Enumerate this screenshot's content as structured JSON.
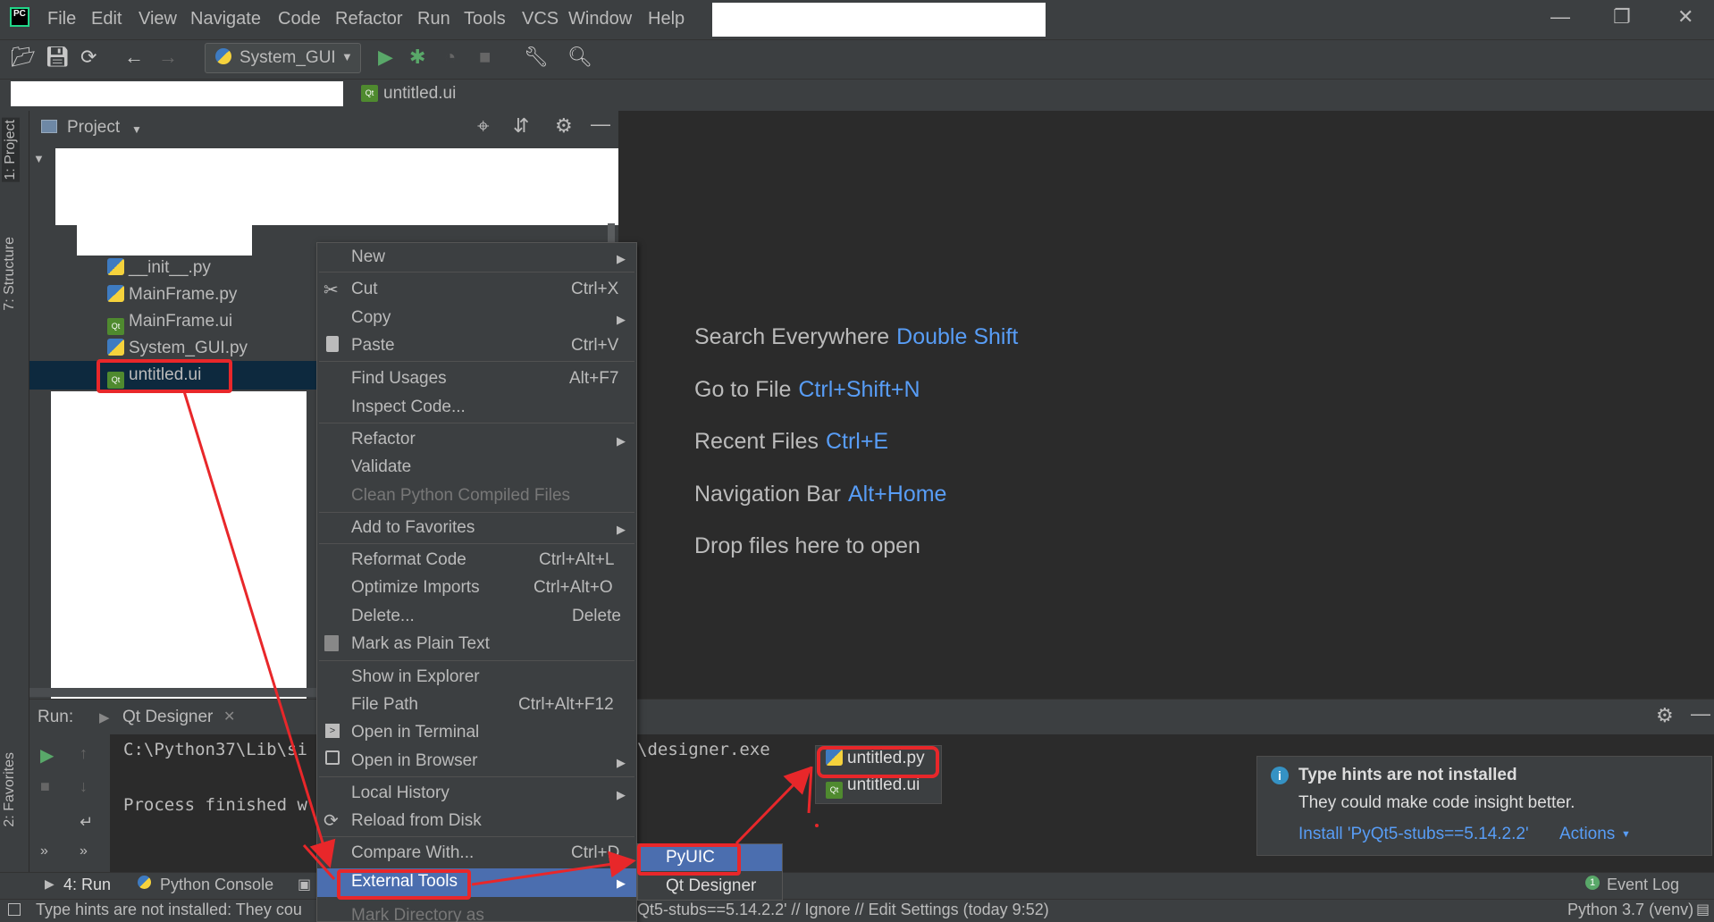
{
  "menubar": {
    "items": [
      "File",
      "Edit",
      "View",
      "Navigate",
      "Code",
      "Refactor",
      "Run",
      "Tools",
      "VCS",
      "Window",
      "Help"
    ],
    "logo_text": "PC"
  },
  "window_controls": {
    "minimize": "—",
    "restore": "❐",
    "close": "✕"
  },
  "toolbar": {
    "run_config": "System_GUI"
  },
  "breadcrumb": {
    "file": "untitled.ui"
  },
  "left_stripe": {
    "project_tab": "1: Project",
    "structure_tab": "7: Structure",
    "favorites_tab": "2: Favorites"
  },
  "project": {
    "title": "Project",
    "files": [
      "__init__.py",
      "MainFrame.py",
      "MainFrame.ui",
      "System_GUI.py",
      "untitled.ui"
    ]
  },
  "editor_hints": [
    {
      "label": "Search Everywhere",
      "key": "Double Shift"
    },
    {
      "label": "Go to File",
      "key": "Ctrl+Shift+N"
    },
    {
      "label": "Recent Files",
      "key": "Ctrl+E"
    },
    {
      "label": "Navigation Bar",
      "key": "Alt+Home"
    },
    {
      "label": "Drop files here to open",
      "key": ""
    }
  ],
  "run_panel": {
    "label": "Run:",
    "tab": "Qt Designer",
    "line1_start": "C:\\Python37\\Lib\\si",
    "line1_end": "\\designer.exe",
    "line2": "Process finished w"
  },
  "context_menu": {
    "new": "New",
    "cut": "Cut",
    "cut_sc": "Ctrl+X",
    "copy": "Copy",
    "paste": "Paste",
    "paste_sc": "Ctrl+V",
    "find_usages": "Find Usages",
    "find_usages_sc": "Alt+F7",
    "inspect_code": "Inspect Code...",
    "refactor": "Refactor",
    "validate": "Validate",
    "clean_python": "Clean Python Compiled Files",
    "add_favorites": "Add to Favorites",
    "reformat": "Reformat Code",
    "reformat_sc": "Ctrl+Alt+L",
    "optimize": "Optimize Imports",
    "optimize_sc": "Ctrl+Alt+O",
    "delete": "Delete...",
    "delete_sc": "Delete",
    "mark_plain": "Mark as Plain Text",
    "show_explorer": "Show in Explorer",
    "file_path": "File Path",
    "file_path_sc": "Ctrl+Alt+F12",
    "open_terminal": "Open in Terminal",
    "open_browser": "Open in Browser",
    "local_history": "Local History",
    "reload_disk": "Reload from Disk",
    "compare_with": "Compare With...",
    "compare_sc": "Ctrl+D",
    "external_tools": "External Tools",
    "mark_directory": "Mark Directory as"
  },
  "submenu": {
    "pyuic": "PyUIC",
    "qt_designer": "Qt Designer"
  },
  "generated_files": {
    "py": "untitled.py",
    "ui": "untitled.ui"
  },
  "notification": {
    "title": "Type hints are not installed",
    "body": "They could make code insight better.",
    "install_link": "Install 'PyQt5-stubs==5.14.2.2'",
    "actions": "Actions"
  },
  "bottom_bar": {
    "run_tab": "4: Run",
    "python_console": "Python Console",
    "event_log": "Event Log",
    "event_count": "1"
  },
  "status_bar": {
    "left": "Type hints are not installed: They cou",
    "middle": "Qt5-stubs==5.14.2.2' // Ignore // Edit Settings (today 9:52)",
    "right": "Python 3.7 (venv)"
  },
  "colors": {
    "highlight_red": "#e8272a",
    "link_blue": "#589df6",
    "selection": "#4b6eaf"
  }
}
